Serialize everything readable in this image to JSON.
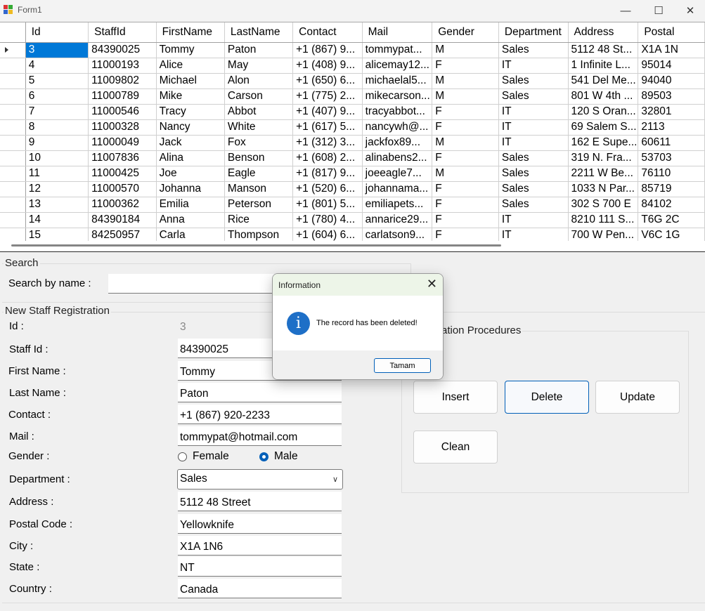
{
  "window": {
    "title": "Form1",
    "minimize": "—",
    "maximize": "☐",
    "close": "✕"
  },
  "grid": {
    "columns": [
      "Id",
      "StaffId",
      "FirstName",
      "LastName",
      "Contact",
      "Mail",
      "Gender",
      "Department",
      "Address",
      "Postal"
    ],
    "rows": [
      [
        "3",
        "84390025",
        "Tommy",
        "Paton",
        "+1 (867) 9...",
        "tommypat...",
        "M",
        "Sales",
        "5112 48 St...",
        "X1A 1N"
      ],
      [
        "4",
        "11000193",
        "Alice",
        "May",
        "+1 (408) 9...",
        "alicemay12...",
        "F",
        "IT",
        "1 Infinite L...",
        "95014"
      ],
      [
        "5",
        "11009802",
        "Michael",
        "Alon",
        "+1 (650) 6...",
        "michaelal5...",
        "M",
        "Sales",
        "541 Del Me...",
        "94040"
      ],
      [
        "6",
        "11000789",
        "Mike",
        "Carson",
        "+1 (775) 2...",
        "mikecarson...",
        "M",
        "Sales",
        "801 W 4th ...",
        "89503"
      ],
      [
        "7",
        "11000546",
        "Tracy",
        "Abbot",
        "+1 (407) 9...",
        "tracyabbot...",
        "F",
        "IT",
        "120 S Oran...",
        "32801"
      ],
      [
        "8",
        "11000328",
        "Nancy",
        "White",
        "+1 (617) 5...",
        "nancywh@...",
        "F",
        "IT",
        "69 Salem S...",
        "2113"
      ],
      [
        "9",
        "11000049",
        "Jack",
        "Fox",
        "+1 (312) 3...",
        "jackfox89...",
        "M",
        "IT",
        "162 E Supe...",
        "60611"
      ],
      [
        "10",
        "11007836",
        "Alina",
        "Benson",
        "+1 (608) 2...",
        "alinabens2...",
        "F",
        "Sales",
        "319 N. Fra...",
        "53703"
      ],
      [
        "11",
        "11000425",
        "Joe",
        "Eagle",
        "+1 (817) 9...",
        "joeeagle7...",
        "M",
        "Sales",
        "2211 W Be...",
        "76110"
      ],
      [
        "12",
        "11000570",
        "Johanna",
        "Manson",
        "+1 (520) 6...",
        "johannama...",
        "F",
        "Sales",
        "1033 N Par...",
        "85719"
      ],
      [
        "13",
        "11000362",
        "Emilia",
        "Peterson",
        "+1 (801) 5...",
        "emiliapets...",
        "F",
        "Sales",
        "302 S 700 E",
        "84102"
      ],
      [
        "14",
        "84390184",
        "Anna",
        "Rice",
        "+1 (780) 4...",
        "annarice29...",
        "F",
        "IT",
        "8210 111 S...",
        "T6G 2C"
      ],
      [
        "15",
        "84250957",
        "Carla",
        "Thompson",
        "+1 (604) 6...",
        "carlatson9...",
        "F",
        "IT",
        "700 W Pen...",
        "V6C 1G"
      ]
    ]
  },
  "search": {
    "group_title": "Search",
    "label": "Search by name :",
    "value": ""
  },
  "registration": {
    "group_title": "New Staff Registration",
    "labels": {
      "id": "Id :",
      "staff_id": "Staff Id :",
      "first_name": "First Name :",
      "last_name": "Last Name :",
      "contact": "Contact :",
      "mail": "Mail :",
      "gender": "Gender :",
      "department": "Department :",
      "address": "Address :",
      "postal_code": "Postal Code :",
      "city": "City :",
      "state": "State :",
      "country": "Country :"
    },
    "values": {
      "id": "3",
      "staff_id": "84390025",
      "first_name": "Tommy",
      "last_name": "Paton",
      "contact": "+1 (867) 920-2233",
      "mail": "tommypat@hotmail.com",
      "department": "Sales",
      "address": "5112 48 Street",
      "postal_code": "Yellowknife",
      "city": "X1A 1N6",
      "state": "NT",
      "country": "Canada"
    },
    "gender_options": {
      "female": "Female",
      "male": "Male",
      "selected": "male"
    }
  },
  "operations": {
    "group_title": "ation Procedures",
    "insert": "Insert",
    "delete": "Delete",
    "update": "Update",
    "clean": "Clean"
  },
  "dialog": {
    "title": "Information",
    "message": "The record has been deleted!",
    "ok": "Tamam",
    "close": "✕",
    "icon": "i"
  },
  "colors": {
    "selection": "#0078d7",
    "accent": "#005fb8",
    "info_icon": "#1e6fc7",
    "dialog_title_bg": "#edf5e8"
  }
}
